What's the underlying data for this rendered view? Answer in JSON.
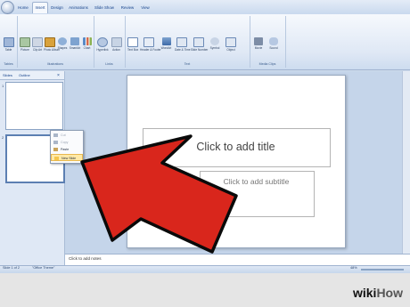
{
  "app": {
    "office_button": "Office button"
  },
  "tabs": [
    {
      "label": "Home",
      "active": false
    },
    {
      "label": "Insert",
      "active": true
    },
    {
      "label": "Design",
      "active": false
    },
    {
      "label": "Animations",
      "active": false
    },
    {
      "label": "Slide Show",
      "active": false
    },
    {
      "label": "Review",
      "active": false
    },
    {
      "label": "View",
      "active": false
    }
  ],
  "ribbon": {
    "groups": [
      "Tables",
      "Illustrations",
      "Links",
      "Text",
      "Media Clips"
    ],
    "buttons": [
      "Table",
      "Picture",
      "Clip Art",
      "Photo Album",
      "Shapes",
      "SmartArt",
      "Chart",
      "Hyperlink",
      "Action",
      "Text Box",
      "Header & Footer",
      "WordArt",
      "Date & Time",
      "Slide Number",
      "Symbol",
      "Object",
      "Movie",
      "Sound"
    ]
  },
  "leftpane": {
    "tab_slides": "Slides",
    "tab_outline": "Outline",
    "slide_numbers": [
      "1",
      "2"
    ]
  },
  "context_menu": {
    "items": [
      {
        "label": "Cut",
        "enabled": false
      },
      {
        "label": "Copy",
        "enabled": false
      },
      {
        "label": "Paste",
        "enabled": true
      },
      {
        "label": "New Slide",
        "enabled": true,
        "highlighted": true
      }
    ]
  },
  "slide": {
    "title_placeholder": "Click to add title",
    "subtitle_placeholder": "Click to add subtitle"
  },
  "notes": {
    "placeholder": "Click to add notes"
  },
  "status": {
    "slide": "Slide 1 of 2",
    "theme": "\"Office Theme\"",
    "zoom": "48%"
  },
  "watermark": {
    "wiki": "wiki",
    "how": "How"
  },
  "colors": {
    "arrow_red": "#d9261c",
    "ribbon_blue": "#15428b"
  }
}
